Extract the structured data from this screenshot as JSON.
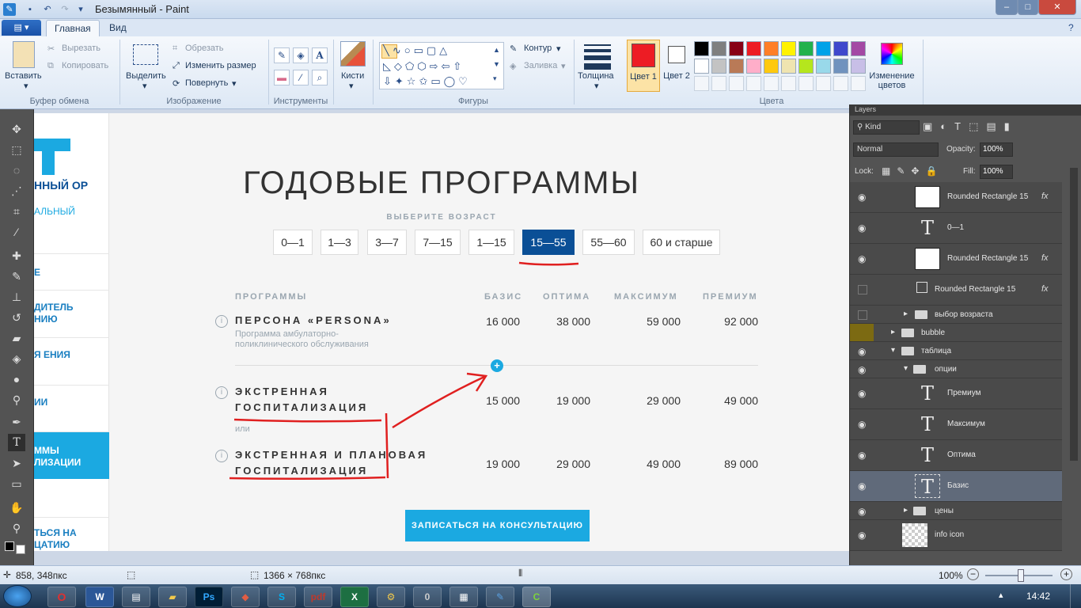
{
  "window": {
    "title": "Безымянный - Paint"
  },
  "tabs": {
    "file": "▤ ▾",
    "home": "Главная",
    "view": "Вид"
  },
  "ribbon": {
    "paste": "Вставить",
    "cut": "Вырезать",
    "copy": "Копировать",
    "clipboard_group": "Буфер обмена",
    "select": "Выделить",
    "crop": "Обрезать",
    "resize": "Изменить размер",
    "rotate": "Повернуть",
    "image_group": "Изображение",
    "tools_group": "Инструменты",
    "brushes": "Кисти",
    "outline": "Контур",
    "fill": "Заливка",
    "shapes_group": "Фигуры",
    "size": "Толщина",
    "color1": "Цвет 1",
    "color2": "Цвет 2",
    "colors_group": "Цвета",
    "edit_colors": "Изменение цветов",
    "palette": [
      "#000000",
      "#7f7f7f",
      "#880015",
      "#ed1c24",
      "#ff7f27",
      "#fff200",
      "#22b14c",
      "#00a2e8",
      "#3f48cc",
      "#a349a4",
      "#ffffff",
      "#c3c3c3",
      "#b97a57",
      "#ffaec9",
      "#ffc90e",
      "#efe4b0",
      "#b5e61d",
      "#99d9ea",
      "#7092be",
      "#c8bfe7"
    ],
    "color1_value": "#ed1c24",
    "color2_value": "#ffffff"
  },
  "web": {
    "side_links": [
      "Е",
      "ДИТЕЛЬ НИЮ",
      "Я ЕНИЯ",
      "ИИ",
      "ММЫ ЛИЗАЦИИ",
      "ТЬСЯ НА ЦАТИЮ"
    ],
    "logo_text": "ННЫЙ ОР",
    "logo_sub": "АЛЬНЫЙ",
    "title": "ГОДОВЫЕ ПРОГРАММЫ",
    "age_label": "ВЫБЕРИТЕ ВОЗРАСТ",
    "ages": [
      "0—1",
      "1—3",
      "3—7",
      "7—15",
      "1—15",
      "15—55",
      "55—60",
      "60 и старше"
    ],
    "selected_age": "15—55",
    "col_programs": "ПРОГРАММЫ",
    "col_basis": "БАЗИС",
    "col_optima": "ОПТИМА",
    "col_maximum": "МАКСИМУМ",
    "col_premium": "ПРЕМИУМ",
    "rows": [
      {
        "name": "ПЕРСОНА «PERSONA»",
        "desc": "Программа амбулаторно-поликлинического обслуживания",
        "basis": "16 000",
        "optima": "38 000",
        "maximum": "59 000",
        "premium": "92 000"
      },
      {
        "name": "ЭКСТРЕННАЯ ГОСПИТАЛИЗАЦИЯ",
        "basis": "15 000",
        "optima": "19 000",
        "maximum": "29 000",
        "premium": "49 000"
      },
      {
        "name": "ЭКСТРЕННАЯ И ПЛАНОВАЯ ГОСПИТАЛИЗАЦИЯ",
        "basis": "19 000",
        "optima": "29 000",
        "maximum": "49 000",
        "premium": "89 000"
      }
    ],
    "or": "или",
    "consult_button": "ЗАПИСАТЬСЯ НА КОНСУЛЬТАЦИЮ"
  },
  "ps": {
    "panel_title": "Layers",
    "kind": "Kind",
    "blend": "Normal",
    "opacity_label": "Opacity:",
    "opacity": "100%",
    "lock_label": "Lock:",
    "fill_label": "Fill:",
    "fill": "100%",
    "layers": [
      "Rounded Rectangle 15",
      "0—1",
      "Rounded Rectangle 15",
      "Rounded Rectangle 15",
      "выбор возраста",
      "bubble",
      "таблица",
      "опции",
      "Премиум",
      "Максимум",
      "Оптима",
      "Базис",
      "цены",
      "info icon"
    ]
  },
  "status": {
    "cursor": "858, 348пкс",
    "size": "1366 × 768пкс",
    "zoom": "100%"
  },
  "taskbar": {
    "clock": "14:42"
  }
}
